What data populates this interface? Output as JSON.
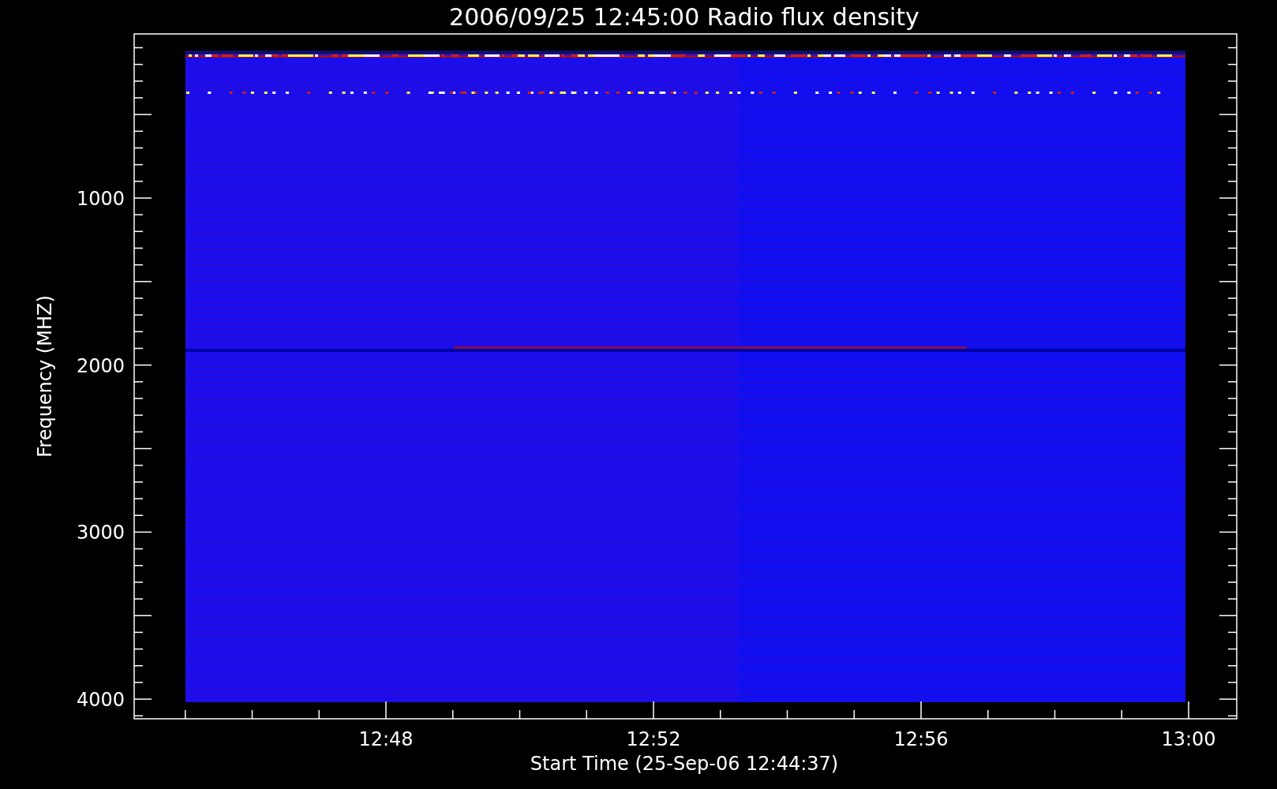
{
  "title": "2006/09/25 12:45:00 Radio flux density",
  "y_axis": {
    "label": "Frequency (MHZ)",
    "tick_labels": [
      "1000",
      "2000",
      "3000",
      "4000"
    ]
  },
  "x_axis": {
    "label": "Start Time (25-Sep-06 12:44:37)",
    "tick_labels": [
      "12:48",
      "12:52",
      "12:56",
      "13:00"
    ]
  }
}
